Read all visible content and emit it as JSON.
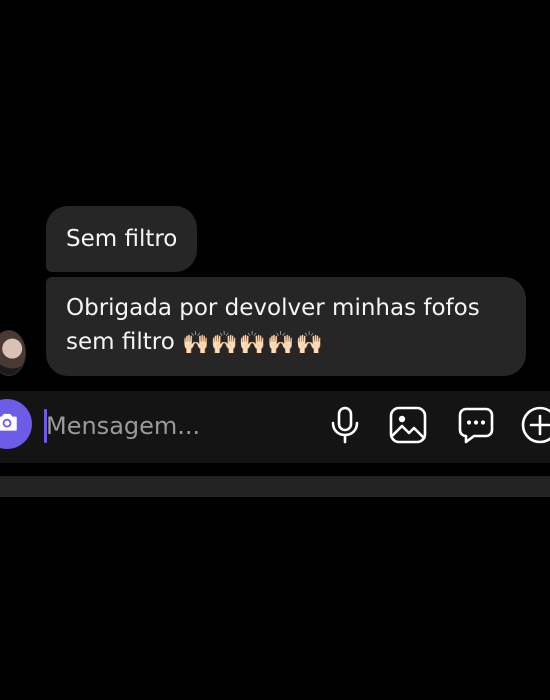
{
  "messages": [
    {
      "text": "Sem filtro"
    },
    {
      "line1": "Obrigada por devolver minhas fofos",
      "line2": "sem filtro",
      "emoji": "🙌🏻🙌🏻🙌🏻🙌🏻🙌🏻"
    }
  ],
  "composer": {
    "placeholder": "Mensagem..."
  },
  "colors": {
    "accent": "#6c5ce7",
    "bubble": "#262626",
    "background": "#000000"
  },
  "icons": [
    "camera-icon",
    "microphone-icon",
    "gallery-icon",
    "sticker-icon",
    "plus-icon"
  ]
}
